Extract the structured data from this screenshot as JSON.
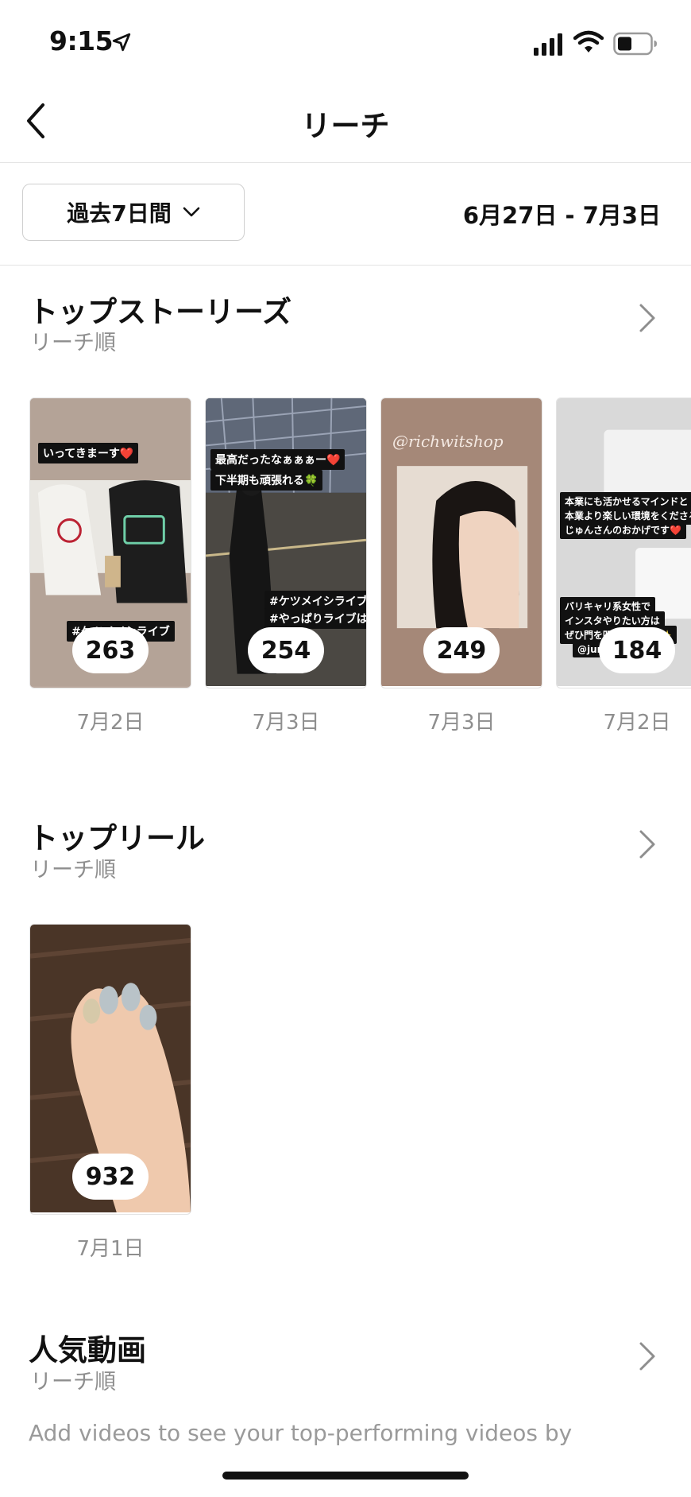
{
  "status_bar": {
    "time": "9:15"
  },
  "nav": {
    "title": "リーチ"
  },
  "filter": {
    "range_label": "過去7日間",
    "date_range": "6月27日 - 7月3日"
  },
  "top_stories": {
    "title": "トップストーリーズ",
    "subtitle": "リーチ順",
    "items": [
      {
        "count": "263",
        "date": "7月2日",
        "stickers": [
          "いってきまーす❤️",
          "#ケツメイシライブ"
        ]
      },
      {
        "count": "254",
        "date": "7月3日",
        "stickers": [
          "最高だったなぁぁぁー❤️",
          "下半期も頑張れる🍀",
          "#ケツメイシライブ",
          "#やっぱりライブは最高"
        ]
      },
      {
        "count": "249",
        "date": "7月3日",
        "stickers": [
          "@richwitshop"
        ]
      },
      {
        "count": "184",
        "date": "7月2日",
        "stickers": [
          "本業にも活かせるマインドと",
          "本業より楽しい環境をくださる",
          "じゅんさんのおかげです❤️",
          "バリキャリ系女性で",
          "インスタやりたい方は",
          "ぜひ門を叩いてほしい✨",
          "@junn"
        ]
      }
    ]
  },
  "top_reels": {
    "title": "トップリール",
    "subtitle": "リーチ順",
    "items": [
      {
        "count": "932",
        "date": "7月1日"
      }
    ]
  },
  "popular_videos": {
    "title": "人気動画",
    "subtitle": "リーチ順",
    "hint": "Add videos to see your top-performing videos by"
  },
  "icons": [
    "location-arrow-icon",
    "signal-icon",
    "wifi-icon",
    "battery-icon",
    "back-chevron-icon",
    "chevron-down-icon",
    "chevron-right-icon"
  ]
}
